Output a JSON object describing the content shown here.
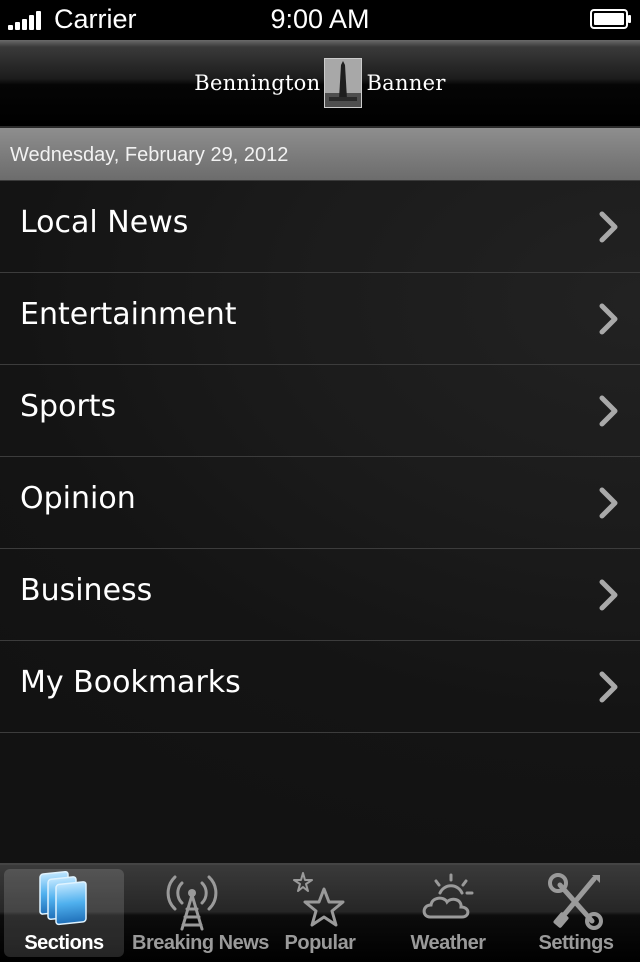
{
  "status_bar": {
    "carrier": "Carrier",
    "time": "9:00 AM"
  },
  "header": {
    "masthead_left": "Bennington",
    "masthead_right": "Banner",
    "logo_icon": "monument-logo-icon"
  },
  "date_bar": {
    "date": "Wednesday, February 29, 2012"
  },
  "sections": {
    "items": [
      {
        "label": "Local News"
      },
      {
        "label": "Entertainment"
      },
      {
        "label": "Sports"
      },
      {
        "label": "Opinion"
      },
      {
        "label": "Business"
      },
      {
        "label": "My Bookmarks"
      }
    ]
  },
  "tab_bar": {
    "tabs": [
      {
        "label": "Sections",
        "icon": "stacked-pages-icon",
        "selected": true
      },
      {
        "label": "Breaking News",
        "icon": "radio-tower-icon",
        "selected": false
      },
      {
        "label": "Popular",
        "icon": "stars-icon",
        "selected": false
      },
      {
        "label": "Weather",
        "icon": "cloud-sun-icon",
        "selected": false
      },
      {
        "label": "Settings",
        "icon": "wrench-screwdriver-icon",
        "selected": false
      }
    ]
  },
  "colors": {
    "accent_selected_icon": "#5cb8f0",
    "list_background": "#121111",
    "date_bar": "#7e7e7e"
  }
}
